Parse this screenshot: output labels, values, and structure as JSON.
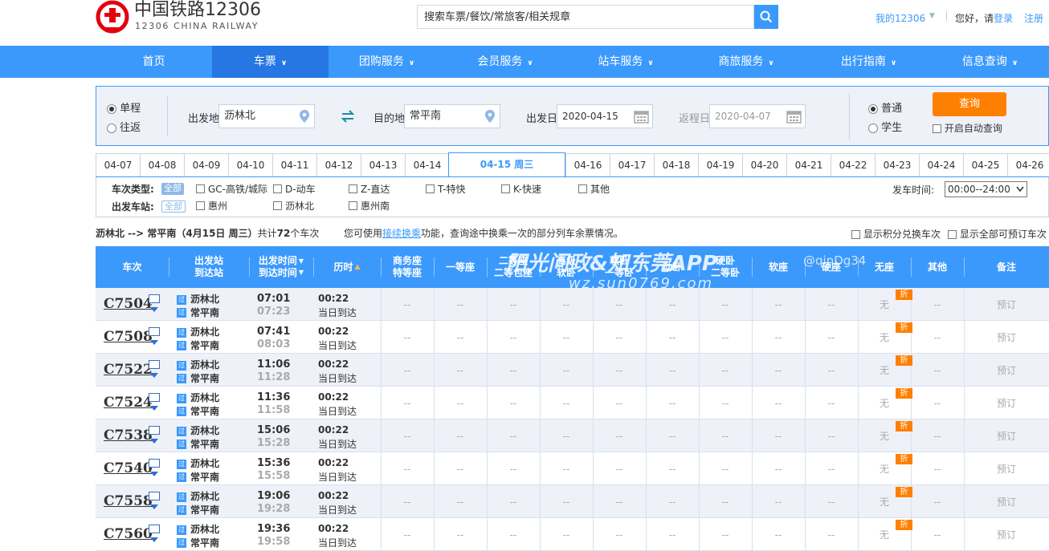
{
  "header": {
    "logo_cn": "中国铁路12306",
    "logo_en": "12306 CHINA RAILWAY",
    "search_placeholder": "搜索车票/餐饮/常旅客/相关规章",
    "my12306": "我的12306",
    "greeting": "您好，请",
    "login": "登录",
    "register": "注册"
  },
  "nav": [
    {
      "label": "首页",
      "has_dropdown": false,
      "active": false
    },
    {
      "label": "车票",
      "has_dropdown": true,
      "active": true
    },
    {
      "label": "团购服务",
      "has_dropdown": true,
      "active": false
    },
    {
      "label": "会员服务",
      "has_dropdown": true,
      "active": false
    },
    {
      "label": "站车服务",
      "has_dropdown": true,
      "active": false
    },
    {
      "label": "商旅服务",
      "has_dropdown": true,
      "active": false
    },
    {
      "label": "出行指南",
      "has_dropdown": true,
      "active": false
    },
    {
      "label": "信息查询",
      "has_dropdown": true,
      "active": false
    }
  ],
  "query": {
    "trip_one_way": "单程",
    "trip_round": "往返",
    "from_label": "出发地",
    "from_value": "沥林北",
    "to_label": "目的地",
    "to_value": "常平南",
    "depart_label": "出发日",
    "depart_value": "2020-04-15",
    "return_label": "返程日",
    "return_value": "2020-04-07",
    "ticket_normal": "普通",
    "ticket_student": "学生",
    "query_button": "查询",
    "auto_query": "开启自动查询"
  },
  "date_tabs": {
    "before": [
      "04-07",
      "04-08",
      "04-09",
      "04-10",
      "04-11",
      "04-12",
      "04-13",
      "04-14"
    ],
    "active": "04-15 周三",
    "after": [
      "04-16",
      "04-17",
      "04-18",
      "04-19",
      "04-20",
      "04-21",
      "04-22",
      "04-23",
      "04-24",
      "04-25",
      "04-26"
    ]
  },
  "filters": {
    "type_label": "车次类型:",
    "station_label": "出发车站:",
    "all": "全部",
    "types": [
      "GC-高铁/城际",
      "D-动车",
      "Z-直达",
      "T-特快",
      "K-快速",
      "其他"
    ],
    "stations": [
      "惠州",
      "沥林北",
      "惠州南"
    ],
    "time_label": "发车时间:",
    "time_value": "00:00--24:00"
  },
  "summary": {
    "route": "沥林北 --> 常平南（4月15日 周三）",
    "count_prefix": "共计",
    "count": "72",
    "count_suffix": "个车次",
    "tip_prefix": "您可使用",
    "tip_link": "接续换乘",
    "tip_suffix": "功能，查询途中换乘一次的部分列车余票情况。",
    "opt_points": "显示积分兑换车次",
    "opt_bookable": "显示全部可预订车次"
  },
  "table": {
    "headers": {
      "train": "车次",
      "stations_1": "出发站",
      "stations_2": "到达站",
      "times_1": "出发时间",
      "times_2": "到达时间",
      "duration": "历时",
      "business_1": "商务座",
      "business_2": "特等座",
      "first": "一等座",
      "second_1": "二等座",
      "second_2": "二等包座",
      "soft_sleeper_1": "高级",
      "soft_sleeper_2": "软卧",
      "soft_sleeper_3_1": "软卧",
      "soft_sleeper_3_2": "一等卧",
      "motor_sleeper": "动卧",
      "hard_sleeper_1": "硬卧",
      "hard_sleeper_2": "二等卧",
      "soft_seat": "软座",
      "hard_seat": "硬座",
      "no_seat": "无座",
      "other": "其他",
      "note": "备注"
    },
    "rows": [
      {
        "train": "C7504",
        "from": "沥林北",
        "to": "常平南",
        "dep": "07:01",
        "arr": "07:23",
        "duration": "00:22",
        "arrive_note": "当日到达",
        "no_seat": "无",
        "discount": "折",
        "book": "预订"
      },
      {
        "train": "C7508",
        "from": "沥林北",
        "to": "常平南",
        "dep": "07:41",
        "arr": "08:03",
        "duration": "00:22",
        "arrive_note": "当日到达",
        "no_seat": "无",
        "discount": "折",
        "book": "预订"
      },
      {
        "train": "C7522",
        "from": "沥林北",
        "to": "常平南",
        "dep": "11:06",
        "arr": "11:28",
        "duration": "00:22",
        "arrive_note": "当日到达",
        "no_seat": "无",
        "discount": "折",
        "book": "预订"
      },
      {
        "train": "C7524",
        "from": "沥林北",
        "to": "常平南",
        "dep": "11:36",
        "arr": "11:58",
        "duration": "00:22",
        "arrive_note": "当日到达",
        "no_seat": "无",
        "discount": "折",
        "book": "预订"
      },
      {
        "train": "C7538",
        "from": "沥林北",
        "to": "常平南",
        "dep": "15:06",
        "arr": "15:28",
        "duration": "00:22",
        "arrive_note": "当日到达",
        "no_seat": "无",
        "discount": "折",
        "book": "预订"
      },
      {
        "train": "C7540",
        "from": "沥林北",
        "to": "常平南",
        "dep": "15:36",
        "arr": "15:58",
        "duration": "00:22",
        "arrive_note": "当日到达",
        "no_seat": "无",
        "discount": "折",
        "book": "预订"
      },
      {
        "train": "C7558",
        "from": "沥林北",
        "to": "常平南",
        "dep": "19:06",
        "arr": "19:28",
        "duration": "00:22",
        "arrive_note": "当日到达",
        "no_seat": "无",
        "discount": "折",
        "book": "预订"
      },
      {
        "train": "C7560",
        "from": "沥林北",
        "to": "常平南",
        "dep": "19:36",
        "arr": "19:58",
        "duration": "00:22",
        "arrive_note": "当日到达",
        "no_seat": "无",
        "discount": "折",
        "book": "预订"
      }
    ],
    "empty": "--",
    "station_badge": "过"
  },
  "watermark": {
    "line1": "阳光问政&知东莞APP",
    "line2": "wz.sun0769.com",
    "line3": "@qinDg34"
  },
  "colors": {
    "brand_blue": "#3b99fc",
    "nav_active": "#2676e3",
    "query_orange": "#ff8000",
    "logo_red": "#e3000f"
  }
}
